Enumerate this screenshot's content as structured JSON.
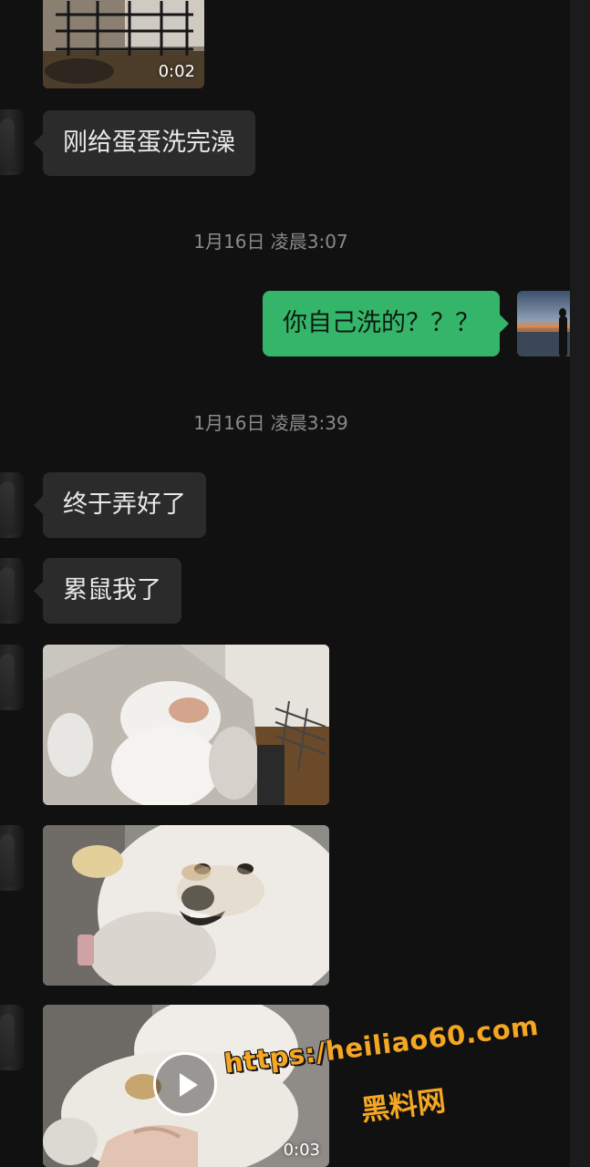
{
  "messages": {
    "video1": {
      "duration": "0:02"
    },
    "text1": "刚给蛋蛋洗完澡",
    "time1": "1月16日 凌晨3:07",
    "reply1": "你自己洗的？？？",
    "time2": "1月16日 凌晨3:39",
    "text2": "终于弄好了",
    "text3": "累鼠我了",
    "video2": {
      "duration": "0:03"
    }
  },
  "watermark": {
    "url": "https:/heiliao60.com",
    "name": "黑料网"
  },
  "colors": {
    "background": "#111111",
    "incoming_bubble": "#2b2b2b",
    "outgoing_bubble": "#35b56a",
    "watermark": "#f5a623"
  }
}
